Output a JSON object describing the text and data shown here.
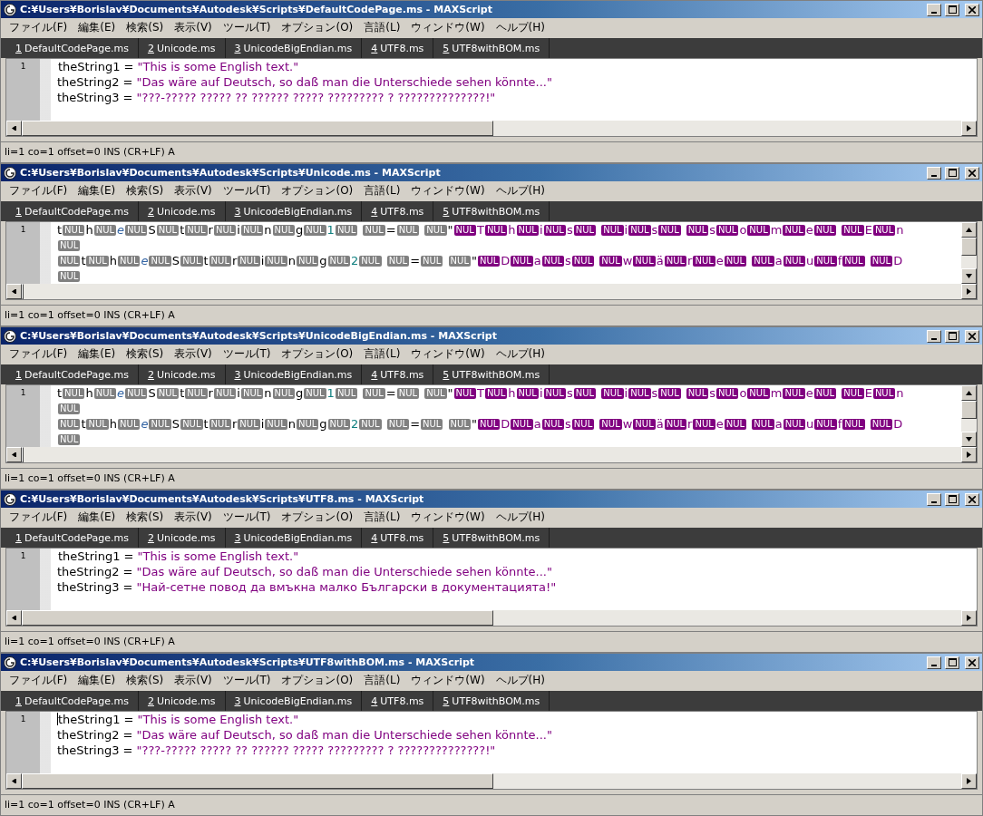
{
  "windows": [
    {
      "title": "C:¥Users¥Borislav¥Documents¥Autodesk¥Scripts¥DefaultCodePage.ms - MAXScript",
      "menu": [
        "ファイル(F)",
        "編集(E)",
        "検索(S)",
        "表示(V)",
        "ツール(T)",
        "オプション(O)",
        "言語(L)",
        "ウィンドウ(W)",
        "ヘルプ(H)"
      ],
      "tabs": [
        {
          "key": "1",
          "label": "DefaultCodePage.ms"
        },
        {
          "key": "2",
          "label": "Unicode.ms"
        },
        {
          "key": "3",
          "label": "UnicodeBigEndian.ms"
        },
        {
          "key": "4",
          "label": "UTF8.ms"
        },
        {
          "key": "5",
          "label": "UTF8withBOM.ms"
        }
      ],
      "editor": {
        "kind": "text",
        "line_number": "1",
        "cursor": false,
        "vertical_scrollbar": false,
        "lines": [
          {
            "code": "theString1 = ",
            "string": "\"This is some English text.\""
          },
          {
            "code": "theString2 = ",
            "string": "\"Das wäre auf Deutsch, so daß man die Unterschiede sehen könnte...\""
          },
          {
            "code": "theString3 = ",
            "string": "\"???-????? ????? ?? ?????? ????? ????????? ? ??????????????!\""
          }
        ]
      },
      "status": "li=1 co=1 offset=0 INS (CR+LF) A"
    },
    {
      "title": "C:¥Users¥Borislav¥Documents¥Autodesk¥Scripts¥Unicode.ms - MAXScript",
      "menu": [
        "ファイル(F)",
        "編集(E)",
        "検索(S)",
        "表示(V)",
        "ツール(T)",
        "オプション(O)",
        "言語(L)",
        "ウィンドウ(W)",
        "ヘルプ(H)"
      ],
      "tabs": [
        {
          "key": "1",
          "label": "DefaultCodePage.ms"
        },
        {
          "key": "2",
          "label": "Unicode.ms"
        },
        {
          "key": "3",
          "label": "UnicodeBigEndian.ms"
        },
        {
          "key": "4",
          "label": "UTF8.ms"
        },
        {
          "key": "5",
          "label": "UTF8withBOM.ms"
        }
      ],
      "editor": {
        "kind": "nul",
        "line_number": "1",
        "cursor": false,
        "vertical_scrollbar": true,
        "rows": [
          [
            {
              "char": "t",
              "nul": "NUL",
              "kind": "plain"
            },
            {
              "char": "h",
              "nul": "NUL",
              "kind": "plain"
            },
            {
              "char": "e",
              "nul": "NUL",
              "kind": "keyword"
            },
            {
              "char": "S",
              "nul": "NUL",
              "kind": "plain"
            },
            {
              "char": "t",
              "nul": "NUL",
              "kind": "plain"
            },
            {
              "char": "r",
              "nul": "NUL",
              "kind": "plain"
            },
            {
              "char": "i",
              "nul": "NUL",
              "kind": "plain"
            },
            {
              "char": "n",
              "nul": "NUL",
              "kind": "plain"
            },
            {
              "char": "g",
              "nul": "NUL",
              "kind": "plain"
            },
            {
              "char": "1",
              "nul": "NUL",
              "kind": "number"
            },
            {
              "nul": "NUL",
              "kind": "space"
            },
            {
              "char": "=",
              "nul": "NUL",
              "kind": "plain"
            },
            {
              "nul": "NUL",
              "kind": "space"
            },
            {
              "char": "\"",
              "nul": "NUL",
              "kind": "quote"
            },
            {
              "char": "T",
              "nul": "NUL",
              "kind": "string"
            },
            {
              "char": "h",
              "nul": "NUL",
              "kind": "string"
            },
            {
              "char": "i",
              "nul": "NUL",
              "kind": "string"
            },
            {
              "char": "s",
              "nul": "NUL",
              "kind": "string"
            },
            {
              "nul": "NUL",
              "kind": "string-space"
            },
            {
              "char": "i",
              "nul": "NUL",
              "kind": "string"
            },
            {
              "char": "s",
              "nul": "NUL",
              "kind": "string"
            },
            {
              "nul": "NUL",
              "kind": "string-space"
            },
            {
              "char": "s",
              "nul": "NUL",
              "kind": "string"
            },
            {
              "char": "o",
              "nul": "NUL",
              "kind": "string"
            },
            {
              "char": "m",
              "nul": "NUL",
              "kind": "string"
            },
            {
              "char": "e",
              "nul": "NUL",
              "kind": "string"
            },
            {
              "nul": "NUL",
              "kind": "string-space"
            },
            {
              "char": "E",
              "nul": "NUL",
              "kind": "string"
            },
            {
              "char": "n",
              "kind": "string"
            }
          ],
          [
            {
              "nul": "NUL",
              "kind": "plain"
            }
          ],
          [
            {
              "nul": "NUL",
              "kind": "plain"
            },
            {
              "char": "t",
              "nul": "NUL",
              "kind": "plain"
            },
            {
              "char": "h",
              "nul": "NUL",
              "kind": "plain"
            },
            {
              "char": "e",
              "nul": "NUL",
              "kind": "keyword"
            },
            {
              "char": "S",
              "nul": "NUL",
              "kind": "plain"
            },
            {
              "char": "t",
              "nul": "NUL",
              "kind": "plain"
            },
            {
              "char": "r",
              "nul": "NUL",
              "kind": "plain"
            },
            {
              "char": "i",
              "nul": "NUL",
              "kind": "plain"
            },
            {
              "char": "n",
              "nul": "NUL",
              "kind": "plain"
            },
            {
              "char": "g",
              "nul": "NUL",
              "kind": "plain"
            },
            {
              "char": "2",
              "nul": "NUL",
              "kind": "number"
            },
            {
              "nul": "NUL",
              "kind": "space"
            },
            {
              "char": "=",
              "nul": "NUL",
              "kind": "plain"
            },
            {
              "nul": "NUL",
              "kind": "space"
            },
            {
              "char": "\"",
              "nul": "NUL",
              "kind": "quote"
            },
            {
              "char": "D",
              "nul": "NUL",
              "kind": "string"
            },
            {
              "char": "a",
              "nul": "NUL",
              "kind": "string"
            },
            {
              "char": "s",
              "nul": "NUL",
              "kind": "string"
            },
            {
              "nul": "NUL",
              "kind": "string-space"
            },
            {
              "char": "w",
              "nul": "NUL",
              "kind": "string"
            },
            {
              "char": "ä",
              "nul": "NUL",
              "kind": "string"
            },
            {
              "char": "r",
              "nul": "NUL",
              "kind": "string"
            },
            {
              "char": "e",
              "nul": "NUL",
              "kind": "string"
            },
            {
              "nul": "NUL",
              "kind": "string-space"
            },
            {
              "char": "a",
              "nul": "NUL",
              "kind": "string"
            },
            {
              "char": "u",
              "nul": "NUL",
              "kind": "string"
            },
            {
              "char": "f",
              "nul": "NUL",
              "kind": "string"
            },
            {
              "nul": "NUL",
              "kind": "string-space"
            },
            {
              "char": "D",
              "kind": "string"
            }
          ],
          [
            {
              "nul": "NUL",
              "kind": "plain"
            }
          ]
        ]
      },
      "status": "li=1 co=1 offset=0 INS (CR+LF) A"
    },
    {
      "title": "C:¥Users¥Borislav¥Documents¥Autodesk¥Scripts¥UnicodeBigEndian.ms - MAXScript",
      "menu": [
        "ファイル(F)",
        "編集(E)",
        "検索(S)",
        "表示(V)",
        "ツール(T)",
        "オプション(O)",
        "言語(L)",
        "ウィンドウ(W)",
        "ヘルプ(H)"
      ],
      "tabs": [
        {
          "key": "1",
          "label": "DefaultCodePage.ms"
        },
        {
          "key": "2",
          "label": "Unicode.ms"
        },
        {
          "key": "3",
          "label": "UnicodeBigEndian.ms"
        },
        {
          "key": "4",
          "label": "UTF8.ms"
        },
        {
          "key": "5",
          "label": "UTF8withBOM.ms"
        }
      ],
      "editor": {
        "kind": "nul",
        "line_number": "1",
        "cursor": false,
        "vertical_scrollbar": true,
        "rows": [
          [
            {
              "char": "t",
              "nul": "NUL",
              "kind": "plain"
            },
            {
              "char": "h",
              "nul": "NUL",
              "kind": "plain"
            },
            {
              "char": "e",
              "nul": "NUL",
              "kind": "keyword"
            },
            {
              "char": "S",
              "nul": "NUL",
              "kind": "plain"
            },
            {
              "char": "t",
              "nul": "NUL",
              "kind": "plain"
            },
            {
              "char": "r",
              "nul": "NUL",
              "kind": "plain"
            },
            {
              "char": "i",
              "nul": "NUL",
              "kind": "plain"
            },
            {
              "char": "n",
              "nul": "NUL",
              "kind": "plain"
            },
            {
              "char": "g",
              "nul": "NUL",
              "kind": "plain"
            },
            {
              "char": "1",
              "nul": "NUL",
              "kind": "number"
            },
            {
              "nul": "NUL",
              "kind": "space"
            },
            {
              "char": "=",
              "nul": "NUL",
              "kind": "plain"
            },
            {
              "nul": "NUL",
              "kind": "space"
            },
            {
              "char": "\"",
              "nul": "NUL",
              "kind": "quote"
            },
            {
              "char": "T",
              "nul": "NUL",
              "kind": "string"
            },
            {
              "char": "h",
              "nul": "NUL",
              "kind": "string"
            },
            {
              "char": "i",
              "nul": "NUL",
              "kind": "string"
            },
            {
              "char": "s",
              "nul": "NUL",
              "kind": "string"
            },
            {
              "nul": "NUL",
              "kind": "string-space"
            },
            {
              "char": "i",
              "nul": "NUL",
              "kind": "string"
            },
            {
              "char": "s",
              "nul": "NUL",
              "kind": "string"
            },
            {
              "nul": "NUL",
              "kind": "string-space"
            },
            {
              "char": "s",
              "nul": "NUL",
              "kind": "string"
            },
            {
              "char": "o",
              "nul": "NUL",
              "kind": "string"
            },
            {
              "char": "m",
              "nul": "NUL",
              "kind": "string"
            },
            {
              "char": "e",
              "nul": "NUL",
              "kind": "string"
            },
            {
              "nul": "NUL",
              "kind": "string-space"
            },
            {
              "char": "E",
              "nul": "NUL",
              "kind": "string"
            },
            {
              "char": "n",
              "kind": "string"
            }
          ],
          [
            {
              "nul": "NUL",
              "kind": "plain"
            }
          ],
          [
            {
              "nul": "NUL",
              "kind": "plain"
            },
            {
              "char": "t",
              "nul": "NUL",
              "kind": "plain"
            },
            {
              "char": "h",
              "nul": "NUL",
              "kind": "plain"
            },
            {
              "char": "e",
              "nul": "NUL",
              "kind": "keyword"
            },
            {
              "char": "S",
              "nul": "NUL",
              "kind": "plain"
            },
            {
              "char": "t",
              "nul": "NUL",
              "kind": "plain"
            },
            {
              "char": "r",
              "nul": "NUL",
              "kind": "plain"
            },
            {
              "char": "i",
              "nul": "NUL",
              "kind": "plain"
            },
            {
              "char": "n",
              "nul": "NUL",
              "kind": "plain"
            },
            {
              "char": "g",
              "nul": "NUL",
              "kind": "plain"
            },
            {
              "char": "2",
              "nul": "NUL",
              "kind": "number"
            },
            {
              "nul": "NUL",
              "kind": "space"
            },
            {
              "char": "=",
              "nul": "NUL",
              "kind": "plain"
            },
            {
              "nul": "NUL",
              "kind": "space"
            },
            {
              "char": "\"",
              "nul": "NUL",
              "kind": "quote"
            },
            {
              "char": "D",
              "nul": "NUL",
              "kind": "string"
            },
            {
              "char": "a",
              "nul": "NUL",
              "kind": "string"
            },
            {
              "char": "s",
              "nul": "NUL",
              "kind": "string"
            },
            {
              "nul": "NUL",
              "kind": "string-space"
            },
            {
              "char": "w",
              "nul": "NUL",
              "kind": "string"
            },
            {
              "char": "ä",
              "nul": "NUL",
              "kind": "string"
            },
            {
              "char": "r",
              "nul": "NUL",
              "kind": "string"
            },
            {
              "char": "e",
              "nul": "NUL",
              "kind": "string"
            },
            {
              "nul": "NUL",
              "kind": "string-space"
            },
            {
              "char": "a",
              "nul": "NUL",
              "kind": "string"
            },
            {
              "char": "u",
              "nul": "NUL",
              "kind": "string"
            },
            {
              "char": "f",
              "nul": "NUL",
              "kind": "string"
            },
            {
              "nul": "NUL",
              "kind": "string-space"
            },
            {
              "char": "D",
              "kind": "string"
            }
          ],
          [
            {
              "nul": "NUL",
              "kind": "plain"
            }
          ]
        ]
      },
      "status": "li=1 co=1 offset=0 INS (CR+LF) A"
    },
    {
      "title": "C:¥Users¥Borislav¥Documents¥Autodesk¥Scripts¥UTF8.ms - MAXScript",
      "menu": [
        "ファイル(F)",
        "編集(E)",
        "検索(S)",
        "表示(V)",
        "ツール(T)",
        "オプション(O)",
        "言語(L)",
        "ウィンドウ(W)",
        "ヘルプ(H)"
      ],
      "tabs": [
        {
          "key": "1",
          "label": "DefaultCodePage.ms"
        },
        {
          "key": "2",
          "label": "Unicode.ms"
        },
        {
          "key": "3",
          "label": "UnicodeBigEndian.ms"
        },
        {
          "key": "4",
          "label": "UTF8.ms"
        },
        {
          "key": "5",
          "label": "UTF8withBOM.ms"
        }
      ],
      "editor": {
        "kind": "text",
        "line_number": "1",
        "cursor": false,
        "vertical_scrollbar": false,
        "lines": [
          {
            "code": "theString1 = ",
            "string": "\"This is some English text.\""
          },
          {
            "code": "theString2 = ",
            "string": "\"Das wäre auf Deutsch, so daß man die Unterschiede sehen könnte...\""
          },
          {
            "code": "theString3 = ",
            "string": "\"Най-сетне повод да вмъкна малко Български в документацията!\""
          }
        ]
      },
      "status": "li=1 co=1 offset=0 INS (CR+LF) A"
    },
    {
      "title": "C:¥Users¥Borislav¥Documents¥Autodesk¥Scripts¥UTF8withBOM.ms - MAXScript",
      "menu": [
        "ファイル(F)",
        "編集(E)",
        "検索(S)",
        "表示(V)",
        "ツール(T)",
        "オプション(O)",
        "言語(L)",
        "ウィンドウ(W)",
        "ヘルプ(H)"
      ],
      "tabs": [
        {
          "key": "1",
          "label": "DefaultCodePage.ms"
        },
        {
          "key": "2",
          "label": "Unicode.ms"
        },
        {
          "key": "3",
          "label": "UnicodeBigEndian.ms"
        },
        {
          "key": "4",
          "label": "UTF8.ms"
        },
        {
          "key": "5",
          "label": "UTF8withBOM.ms"
        }
      ],
      "editor": {
        "kind": "text",
        "line_number": "1",
        "cursor": true,
        "vertical_scrollbar": false,
        "lines": [
          {
            "code": "theString1 = ",
            "string": "\"This is some English text.\""
          },
          {
            "code": "theString2 = ",
            "string": "\"Das wäre auf Deutsch, so daß man die Unterschiede sehen könnte...\""
          },
          {
            "code": "theString3 = ",
            "string": "\"???-????? ????? ?? ?????? ????? ????????? ? ??????????????!\""
          }
        ]
      },
      "status": "li=1 co=1 offset=0 INS (CR+LF) A"
    }
  ]
}
